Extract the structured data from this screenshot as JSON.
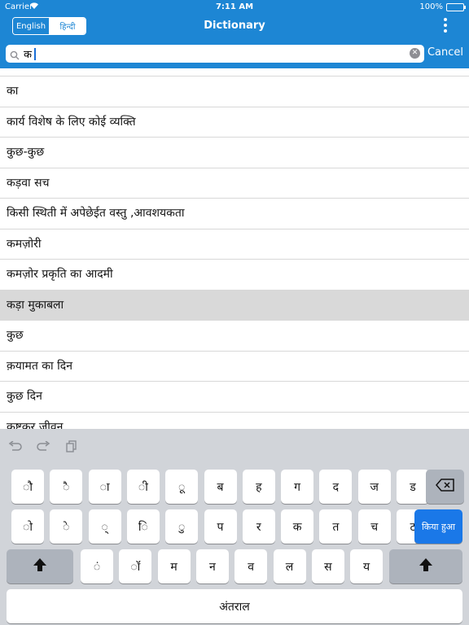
{
  "status": {
    "carrier": "Carrier",
    "time": "7:11 AM",
    "battery": "100%"
  },
  "nav": {
    "segments": [
      "English",
      "हिन्दी"
    ],
    "title": "Dictionary"
  },
  "search": {
    "query": "क",
    "cancel": "Cancel"
  },
  "results": [
    "का",
    "कार्य विशेष के लिए कोई व्यक्ति",
    "कुछ-कुछ",
    "कड़वा सच",
    "किसी स्थिती में अपेछेईत  वस्तु ,आवशयकता",
    "कमज़ोरी",
    "कमज़ोर प्रकृति का आदमी",
    "कड़ा मुकाबला",
    "कुछ",
    "क़यामत का दिन",
    "कुछ दिन",
    "कष्टकर जीवन"
  ],
  "selected_index": 7,
  "keyboard": {
    "row1": [
      "ौ",
      "ै",
      "ा",
      "ी",
      "ू",
      "ब",
      "ह",
      "ग",
      "द",
      "ज",
      "ड"
    ],
    "row2": [
      "ो",
      "े",
      "्",
      "ि",
      "ु",
      "प",
      "र",
      "क",
      "त",
      "च",
      "ट"
    ],
    "row3": [
      "ं",
      "ॉ",
      "म",
      "न",
      "व",
      "ल",
      "स",
      "य"
    ],
    "return": "किया हुआ",
    "space": "अंतराल"
  }
}
